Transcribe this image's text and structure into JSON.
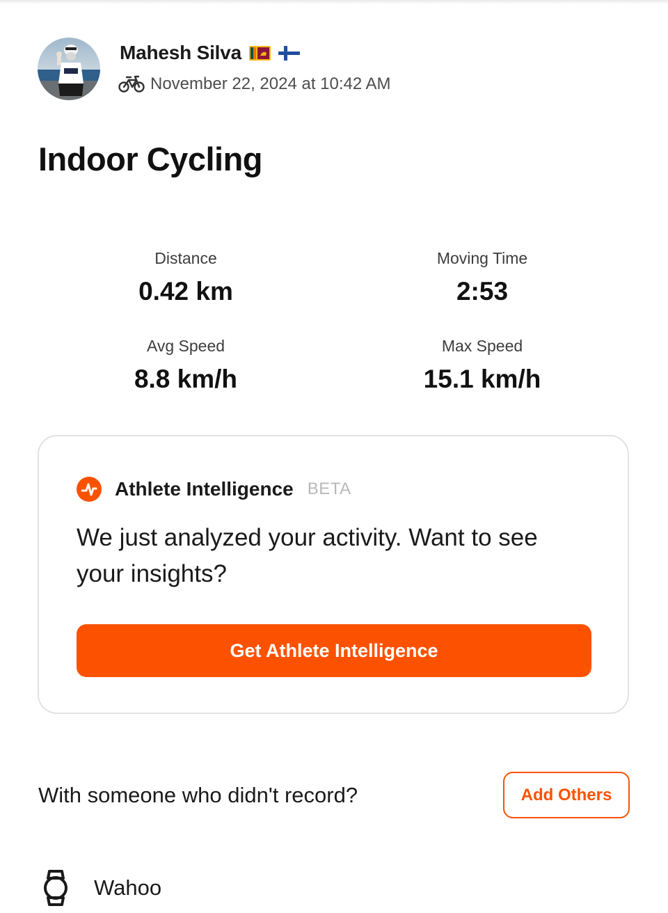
{
  "header": {
    "athlete_name": "Mahesh Silva",
    "flags": [
      "sri-lanka-flag-icon",
      "finland-flag-icon"
    ],
    "activity_type_icon": "bike-icon",
    "datetime": "November 22, 2024 at 10:42 AM"
  },
  "activity": {
    "title": "Indoor Cycling"
  },
  "stats": [
    {
      "label": "Distance",
      "value": "0.42 km"
    },
    {
      "label": "Moving Time",
      "value": "2:53"
    },
    {
      "label": "Avg Speed",
      "value": "8.8 km/h"
    },
    {
      "label": "Max Speed",
      "value": "15.1 km/h"
    }
  ],
  "athlete_intelligence": {
    "icon": "athlete-intelligence-logo-icon",
    "title": "Athlete Intelligence",
    "badge": "BETA",
    "message": "We just analyzed your activity. Want to see your insights?",
    "button_label": "Get Athlete Intelligence"
  },
  "group": {
    "prompt": "With someone who didn't record?",
    "button_label": "Add Others"
  },
  "device": {
    "icon": "watch-icon",
    "name": "Wahoo"
  },
  "colors": {
    "accent": "#fc5200",
    "text": "#1a1a1a",
    "muted": "#b9b9b9",
    "card_border": "#e2e2e2"
  }
}
